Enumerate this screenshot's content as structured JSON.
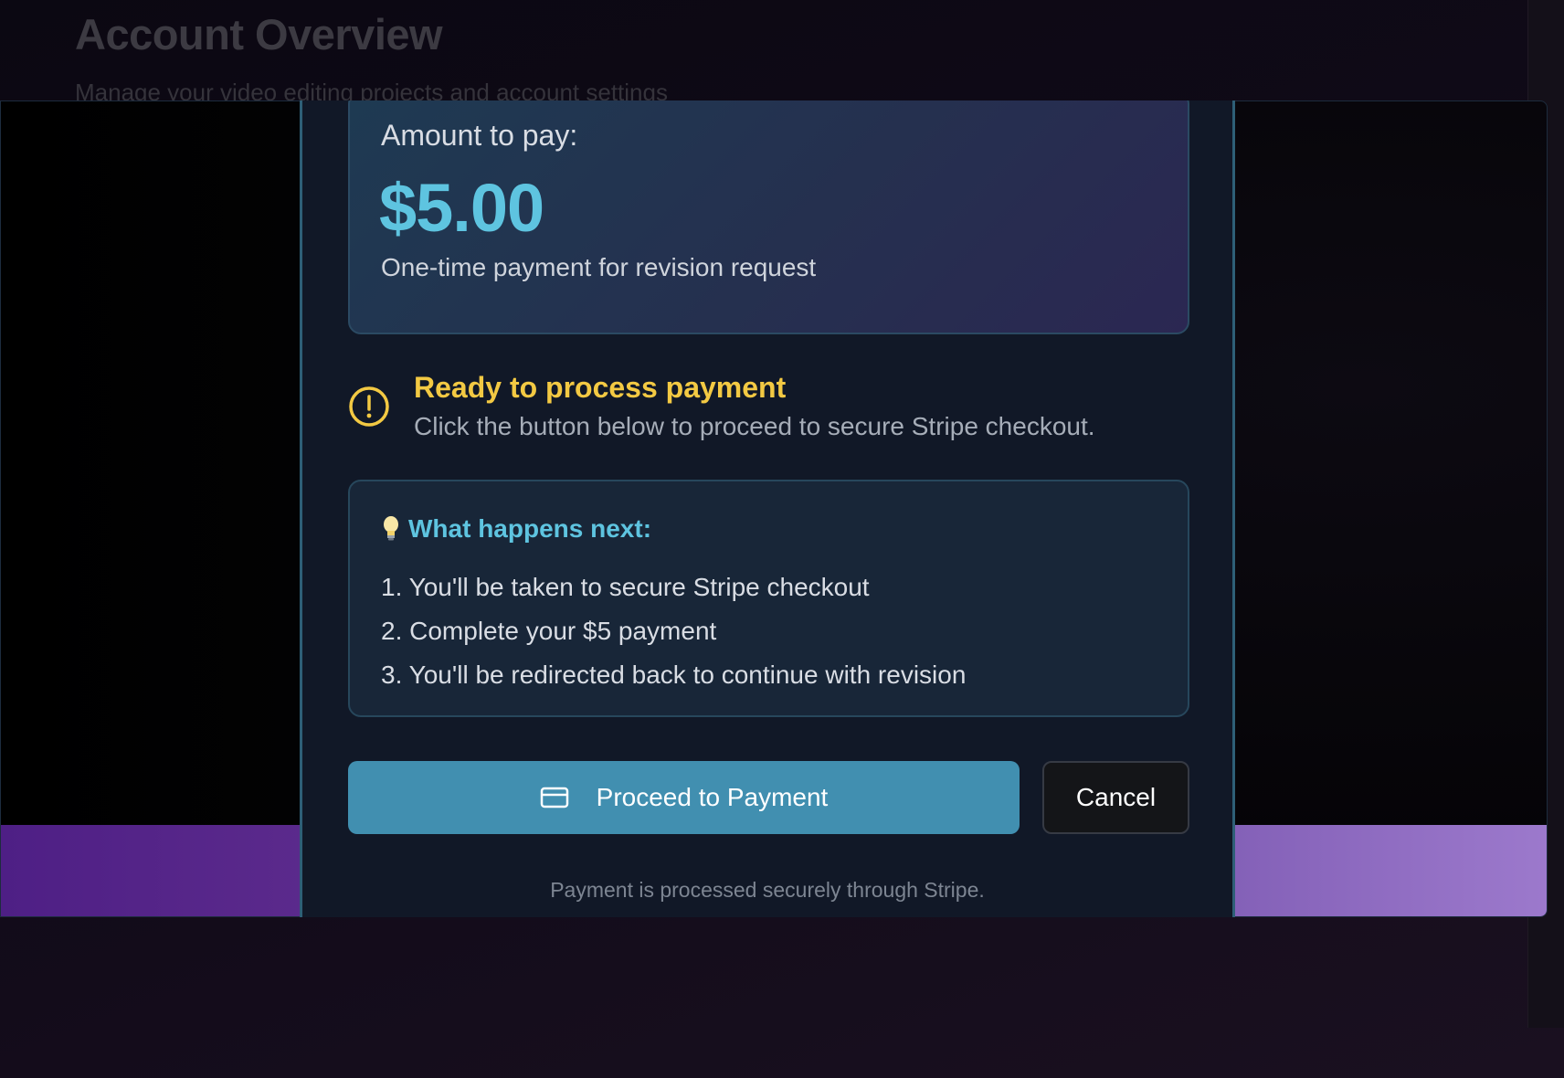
{
  "background": {
    "title": "Account Overview",
    "subtitle": "Manage your video editing projects and account settings"
  },
  "modal": {
    "amount": {
      "label": "Amount to pay:",
      "value": "$5.00",
      "description": "One-time payment for revision request"
    },
    "status": {
      "icon": "alert-circle-icon",
      "title": "Ready to process payment",
      "description": "Click the button below to proceed to secure Stripe checkout."
    },
    "next_steps": {
      "icon": "lightbulb-icon",
      "title": "What happens next:",
      "items": [
        "1. You'll be taken to secure Stripe checkout",
        "2. Complete your $5 payment",
        "3. You'll be redirected back to continue with revision"
      ]
    },
    "buttons": {
      "proceed_label": "Proceed to Payment",
      "proceed_icon": "credit-card-icon",
      "cancel_label": "Cancel"
    },
    "footer": "Payment is processed securely through Stripe."
  },
  "colors": {
    "accent": "#418fb0",
    "amount": "#5ec4e0",
    "warning": "#f3c943"
  }
}
